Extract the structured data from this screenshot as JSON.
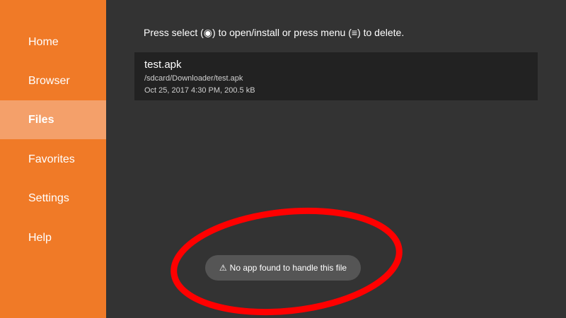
{
  "sidebar": {
    "items": [
      {
        "label": "Home"
      },
      {
        "label": "Browser"
      },
      {
        "label": "Files"
      },
      {
        "label": "Favorites"
      },
      {
        "label": "Settings"
      },
      {
        "label": "Help"
      }
    ],
    "active_item": "Files"
  },
  "main": {
    "instructions": "Press select (◉) to open/install or press menu (≡) to delete.",
    "files": [
      {
        "name": "test.apk",
        "path": "/sdcard/Downloader/test.apk",
        "meta": "Oct 25, 2017 4:30 PM, 200.5 kB"
      }
    ]
  },
  "toast": {
    "icon": "warning-icon",
    "icon_glyph": "⚠",
    "message": "No app found to handle this file"
  },
  "colors": {
    "sidebar": "#f07a27",
    "sidebar_active": "#f4a06a",
    "background": "#333333",
    "file_row": "#222222",
    "toast": "#555555",
    "annotation_circle": "#ff0000"
  }
}
